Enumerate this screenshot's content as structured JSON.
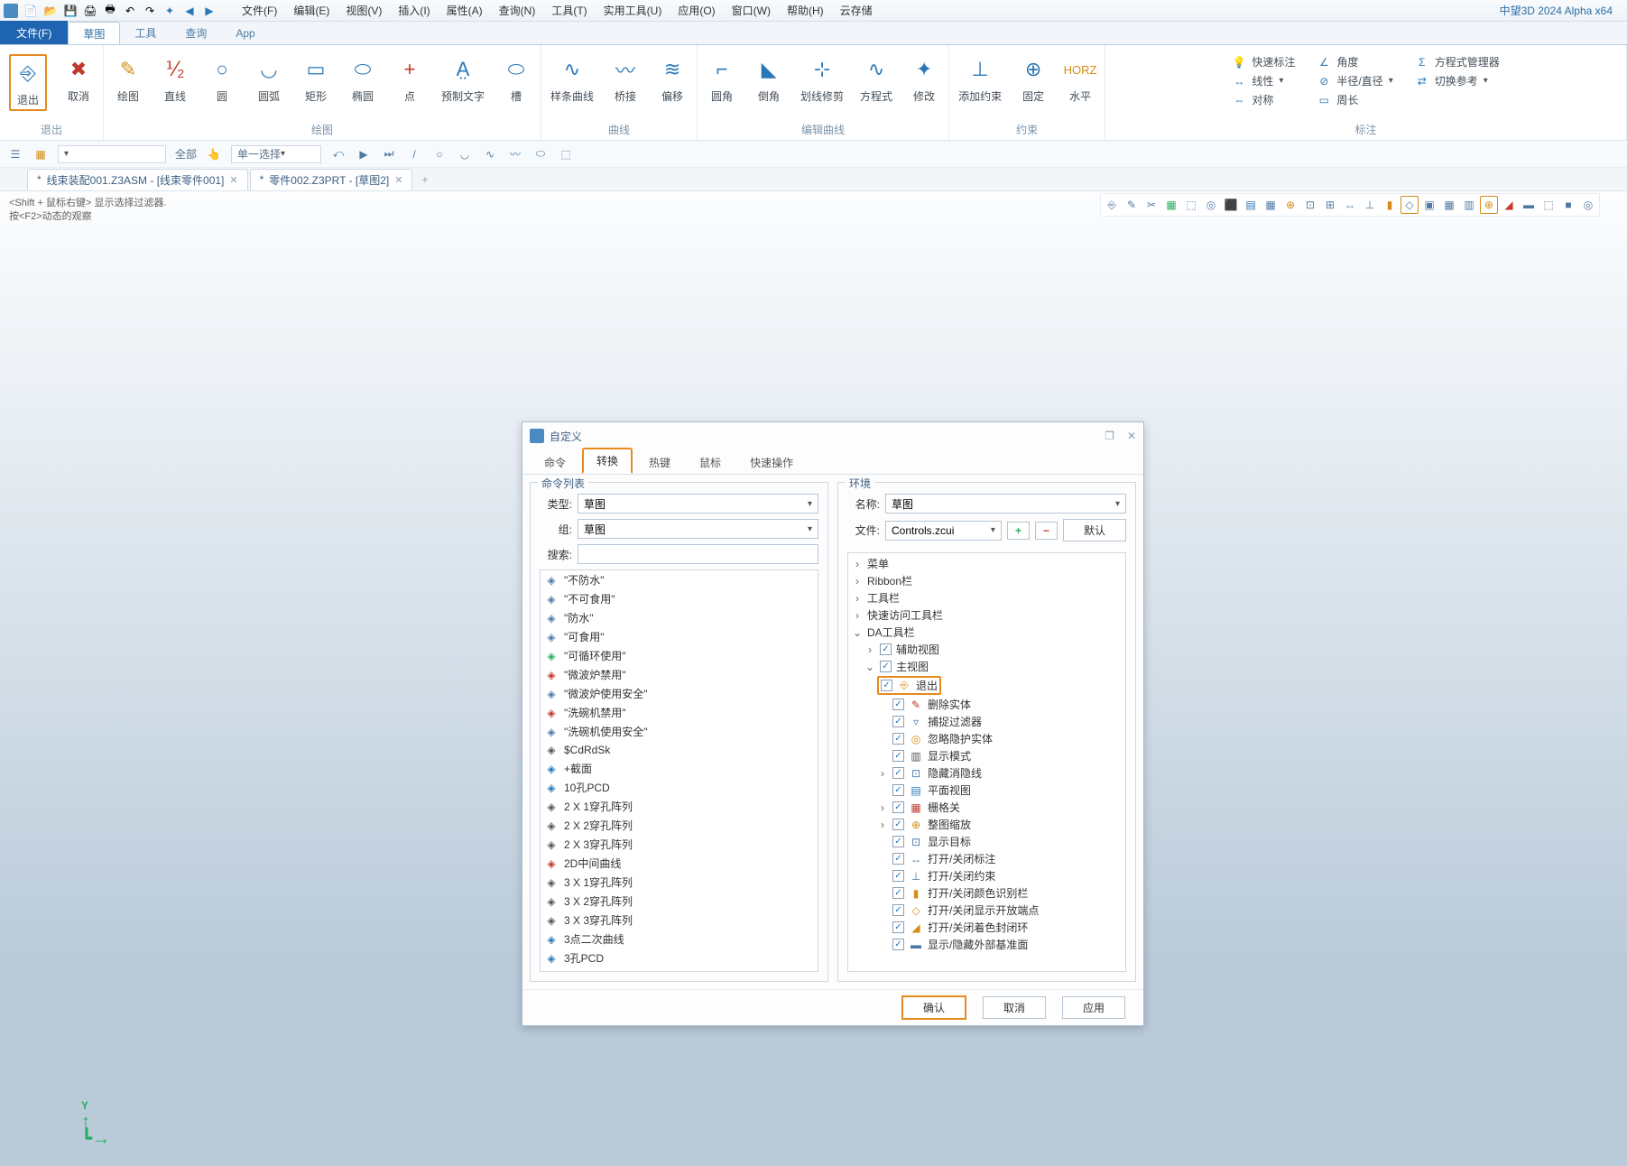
{
  "app_title": "中望3D 2024 Alpha x64",
  "menus": [
    "文件(F)",
    "编辑(E)",
    "视图(V)",
    "插入(I)",
    "属性(A)",
    "查询(N)",
    "工具(T)",
    "实用工具(U)",
    "应用(O)",
    "窗口(W)",
    "帮助(H)",
    "云存储"
  ],
  "tabstrip": {
    "file": "文件(F)",
    "tabs": [
      "草图",
      "工具",
      "查询",
      "App"
    ]
  },
  "ribbon": {
    "g_exit": {
      "label": "退出",
      "exit": "退出",
      "cancel": "取消"
    },
    "g_draw": {
      "label": "绘图",
      "items": [
        "绘图",
        "直线",
        "圆",
        "圆弧",
        "矩形",
        "椭圆",
        "点",
        "预制文字",
        "槽"
      ]
    },
    "g_curve": {
      "label": "曲线",
      "items": [
        "样条曲线",
        "桥接",
        "偏移"
      ]
    },
    "g_edit": {
      "label": "编辑曲线",
      "items": [
        "圆角",
        "倒角",
        "划线修剪",
        "方程式",
        "修改"
      ]
    },
    "g_const": {
      "label": "约束",
      "items": [
        "添加约束",
        "固定",
        "水平"
      ]
    },
    "g_dim": {
      "label": "标注",
      "quick": "快速标注",
      "angle": "角度",
      "linear": "线性",
      "radius": "半径/直径",
      "sym": "对称",
      "perim": "周长",
      "eq": "方程式管理器",
      "switch": "切换参考"
    }
  },
  "quickbar": {
    "all": "全部",
    "single": "单一选择"
  },
  "doctabs": [
    {
      "label": "线束装配001.Z3ASM - [线束零件001]",
      "active": false
    },
    {
      "label": "零件002.Z3PRT - [草图2]",
      "active": true
    }
  ],
  "hints": {
    "h1": "<Shift + 鼠标右键> 显示选择过滤器.",
    "h2": "按<F2>动态的观察"
  },
  "axis": {
    "y": "Y"
  },
  "dialog": {
    "title": "自定义",
    "tabs": [
      "命令",
      "转换",
      "热键",
      "鼠标",
      "快速操作"
    ],
    "left": {
      "legend": "命令列表",
      "type_label": "类型:",
      "type_value": "草图",
      "group_label": "组:",
      "group_value": "草图",
      "search_label": "搜索:",
      "items": [
        "\"不防水\"",
        "\"不可食用\"",
        "\"防水\"",
        "\"可食用\"",
        "\"可循环使用\"",
        "\"微波炉禁用\"",
        "\"微波炉使用安全\"",
        "\"洗碗机禁用\"",
        "\"洗碗机使用安全\"",
        "$CdRdSk",
        "+截面",
        "10孔PCD",
        "2 X 1穿孔阵列",
        "2 X 2穿孔阵列",
        "2 X 3穿孔阵列",
        "2D中间曲线",
        "3 X 1穿孔阵列",
        "3 X 2穿孔阵列",
        "3 X 3穿孔阵列",
        "3点二次曲线",
        "3孔PCD"
      ]
    },
    "right": {
      "legend": "环境",
      "name_label": "名称:",
      "name_value": "草图",
      "file_label": "文件:",
      "file_value": "Controls.zcui",
      "default": "默认",
      "tree": {
        "top": [
          "菜单",
          "Ribbon栏",
          "工具栏",
          "快速访问工具栏"
        ],
        "da": "DA工具栏",
        "aux": "辅助视图",
        "main": "主视图",
        "exit": "退出",
        "others": [
          "删除实体",
          "捕捉过滤器",
          "忽略隐护实体",
          "显示模式",
          "隐藏消隐线",
          "平面视图",
          "栅格关",
          "整图缩放",
          "显示目标",
          "打开/关闭标注",
          "打开/关闭约束",
          "打开/关闭颜色识别栏",
          "打开/关闭显示开放端点",
          "打开/关闭着色封闭环",
          "显示/隐藏外部基准面"
        ]
      }
    },
    "buttons": {
      "ok": "确认",
      "cancel": "取消",
      "apply": "应用"
    }
  }
}
